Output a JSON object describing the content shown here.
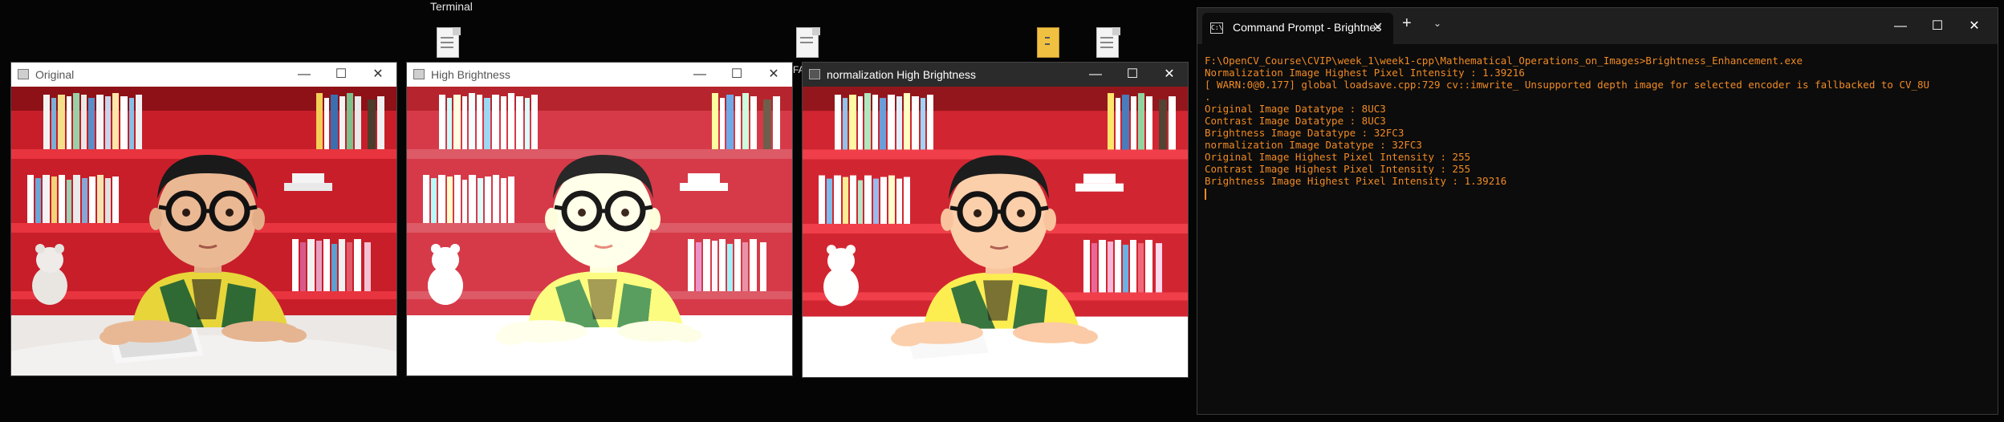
{
  "desktop": {
    "terminal_label": "Terminal",
    "fa_label": "FA"
  },
  "windows": [
    {
      "title": "Original",
      "active": false
    },
    {
      "title": "High Brightness",
      "active": false
    },
    {
      "title": "normalization High Brightness",
      "active": true
    }
  ],
  "window_controls": {
    "minimize": "—",
    "maximize": "☐",
    "close": "✕"
  },
  "terminal": {
    "tab_title": "Command Prompt - Brightnes",
    "new_tab": "+",
    "dropdown": "⌄",
    "lines": [
      "F:\\OpenCV_Course\\CVIP\\week_1\\week1-cpp\\Mathematical_Operations_on_Images>Brightness_Enhancement.exe",
      "Normalization Image Highest Pixel Intensity : 1.39216",
      "[ WARN:0@0.177] global loadsave.cpp:729 cv::imwrite_ Unsupported depth image for selected encoder is fallbacked to CV_8U",
      ".",
      "Original Image Datatype : 8UC3",
      "Contrast Image Datatype : 8UC3",
      "Brightness Image Datatype : 32FC3",
      "normalization Image Datatype : 32FC3",
      "Original Image Highest Pixel Intensity : 255",
      "Contrast Image Highest Pixel Intensity : 255",
      "Brightness Image Highest Pixel Intensity : 1.39216"
    ],
    "text_color": "#f08a24"
  },
  "colors": {
    "desktop_bg": "#050505",
    "terminal_bg": "#0c0c0c",
    "accent_red": "#d8222b"
  }
}
